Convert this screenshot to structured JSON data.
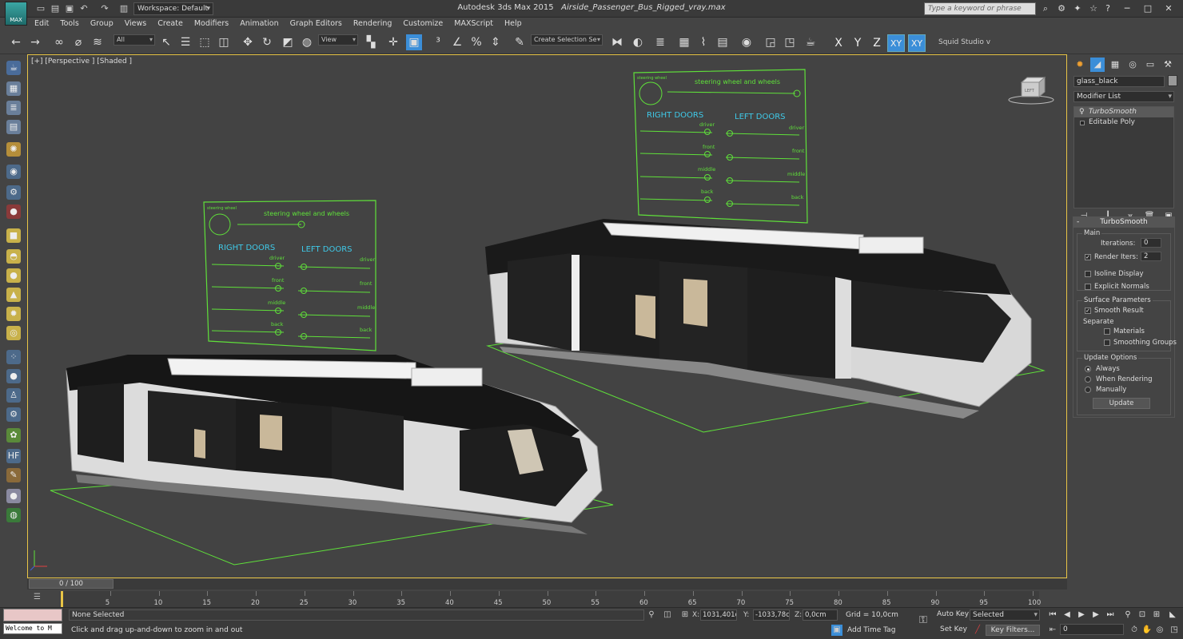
{
  "titlebar": {
    "app_logo": "MAX",
    "workspace": "Workspace: Default",
    "app_name": "Autodesk 3ds Max  2015",
    "file_name": "Airside_Passenger_Bus_Rigged_vray.max",
    "search_placeholder": "Type a keyword or phrase"
  },
  "menu": [
    "Edit",
    "Tools",
    "Group",
    "Views",
    "Create",
    "Modifiers",
    "Animation",
    "Graph Editors",
    "Rendering",
    "Customize",
    "MAXScript",
    "Help"
  ],
  "toolbar": {
    "selection_filter": "All",
    "reference_coord": "View",
    "named_selection": "Create Selection Se",
    "axis_x": "X",
    "axis_y": "Y",
    "axis_z": "Z",
    "axis_xy": "XY",
    "axis_xy2": "XY",
    "workspace_label": "Squid Studio v"
  },
  "viewport": {
    "label": "[+] [Perspective ] [Shaded ]",
    "panel_front": {
      "tiny_label": "steering wheel",
      "header": "steering wheel and wheels",
      "left_doors": "LEFT DOORS",
      "right_doors": "RIGHT DOORS",
      "rows_left": [
        "driver",
        "front",
        "middle",
        "back"
      ],
      "rows_right": [
        "driver",
        "front",
        "middle",
        "back"
      ]
    },
    "panel_back": {
      "tiny_label": "steering wheel",
      "header": "steering wheel and wheels",
      "left_doors": "LEFT DOORS",
      "right_doors": "RIGHT DOORS",
      "rows_left": [
        "driver",
        "front",
        "middle",
        "back"
      ],
      "rows_right": [
        "driver",
        "front",
        "middle",
        "back"
      ]
    },
    "viewcube_label": "LEFT"
  },
  "command_panel": {
    "object_name": "glass_black",
    "modifier_list": "Modifier List",
    "stack": [
      "TurboSmooth",
      "Editable Poly"
    ],
    "rollout_title": "TurboSmooth",
    "main_group": "Main",
    "iterations_label": "Iterations:",
    "iterations_value": "0",
    "render_iters_label": "Render Iters:",
    "render_iters_value": "2",
    "isoline_display": "Isoline Display",
    "explicit_normals": "Explicit Normals",
    "surface_params": "Surface Parameters",
    "smooth_result": "Smooth Result",
    "separate": "Separate",
    "materials": "Materials",
    "smoothing_groups": "Smoothing Groups",
    "update_options": "Update Options",
    "always": "Always",
    "when_rendering": "When Rendering",
    "manually": "Manually",
    "update_button": "Update"
  },
  "timeline": {
    "time_slider": "0 / 100",
    "ticks": [
      "5",
      "10",
      "15",
      "20",
      "25",
      "30",
      "35",
      "40",
      "45",
      "50",
      "55",
      "60",
      "65",
      "70",
      "75",
      "80",
      "85",
      "90",
      "95",
      "100"
    ]
  },
  "status": {
    "welcome": "Welcome to M",
    "selection": "None Selected",
    "prompt": "Click and drag up-and-down to zoom in and out",
    "x_label": "X:",
    "x_value": "1031,401c",
    "y_label": "Y:",
    "y_value": "-1033,78c",
    "z_label": "Z:",
    "z_value": "0,0cm",
    "grid": "Grid = 10,0cm",
    "add_time_tag": "Add Time Tag",
    "auto_key": "Auto Key",
    "key_mode": "Selected",
    "set_key": "Set Key",
    "key_filters": "Key Filters...",
    "frame": "0"
  },
  "colors": {
    "viewport_bg": "#434343",
    "viewport_border": "#e8c547",
    "rig_green": "#5fe03a",
    "rig_cyan": "#3fc9e8",
    "axis_active": "#3b8ed8"
  }
}
